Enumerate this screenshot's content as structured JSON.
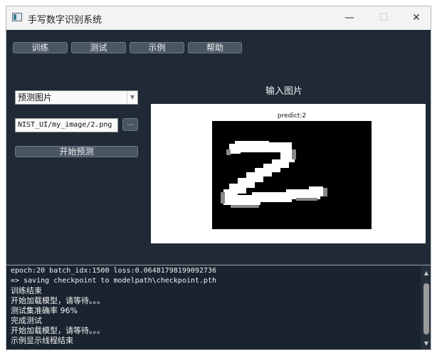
{
  "window": {
    "title": "手写数字识别系统",
    "minimize": "—",
    "maximize": "☐",
    "close": "✕"
  },
  "menu": {
    "train": "训练",
    "test": "测试",
    "example": "示例",
    "help": "帮助"
  },
  "controls": {
    "mode_select": "预测图片",
    "path_value": "NIST_UI/my_image/2.png",
    "browse": "...",
    "predict": "开始预测"
  },
  "preview": {
    "label": "输入图片",
    "prediction": "predict:2"
  },
  "log": {
    "lines": [
      "epoch:20 batch_idx:1500 loss:0.06481798199092736",
      "=> saving checkpoint to modelpath\\checkpoint.pth",
      "训练结束",
      "开始加载模型，请等待。。。",
      "测试集准确率 96%",
      "完成测试",
      "开始加载模型，请等待。。。",
      "示例显示线程结束"
    ]
  },
  "colors": {
    "window_bg": "#1f2a36",
    "button_bg": "#4a5763",
    "log_bg": "#1a2430"
  },
  "icons": [
    "app-icon",
    "chevron-down-icon",
    "scroll-up-icon",
    "scroll-down-icon"
  ]
}
